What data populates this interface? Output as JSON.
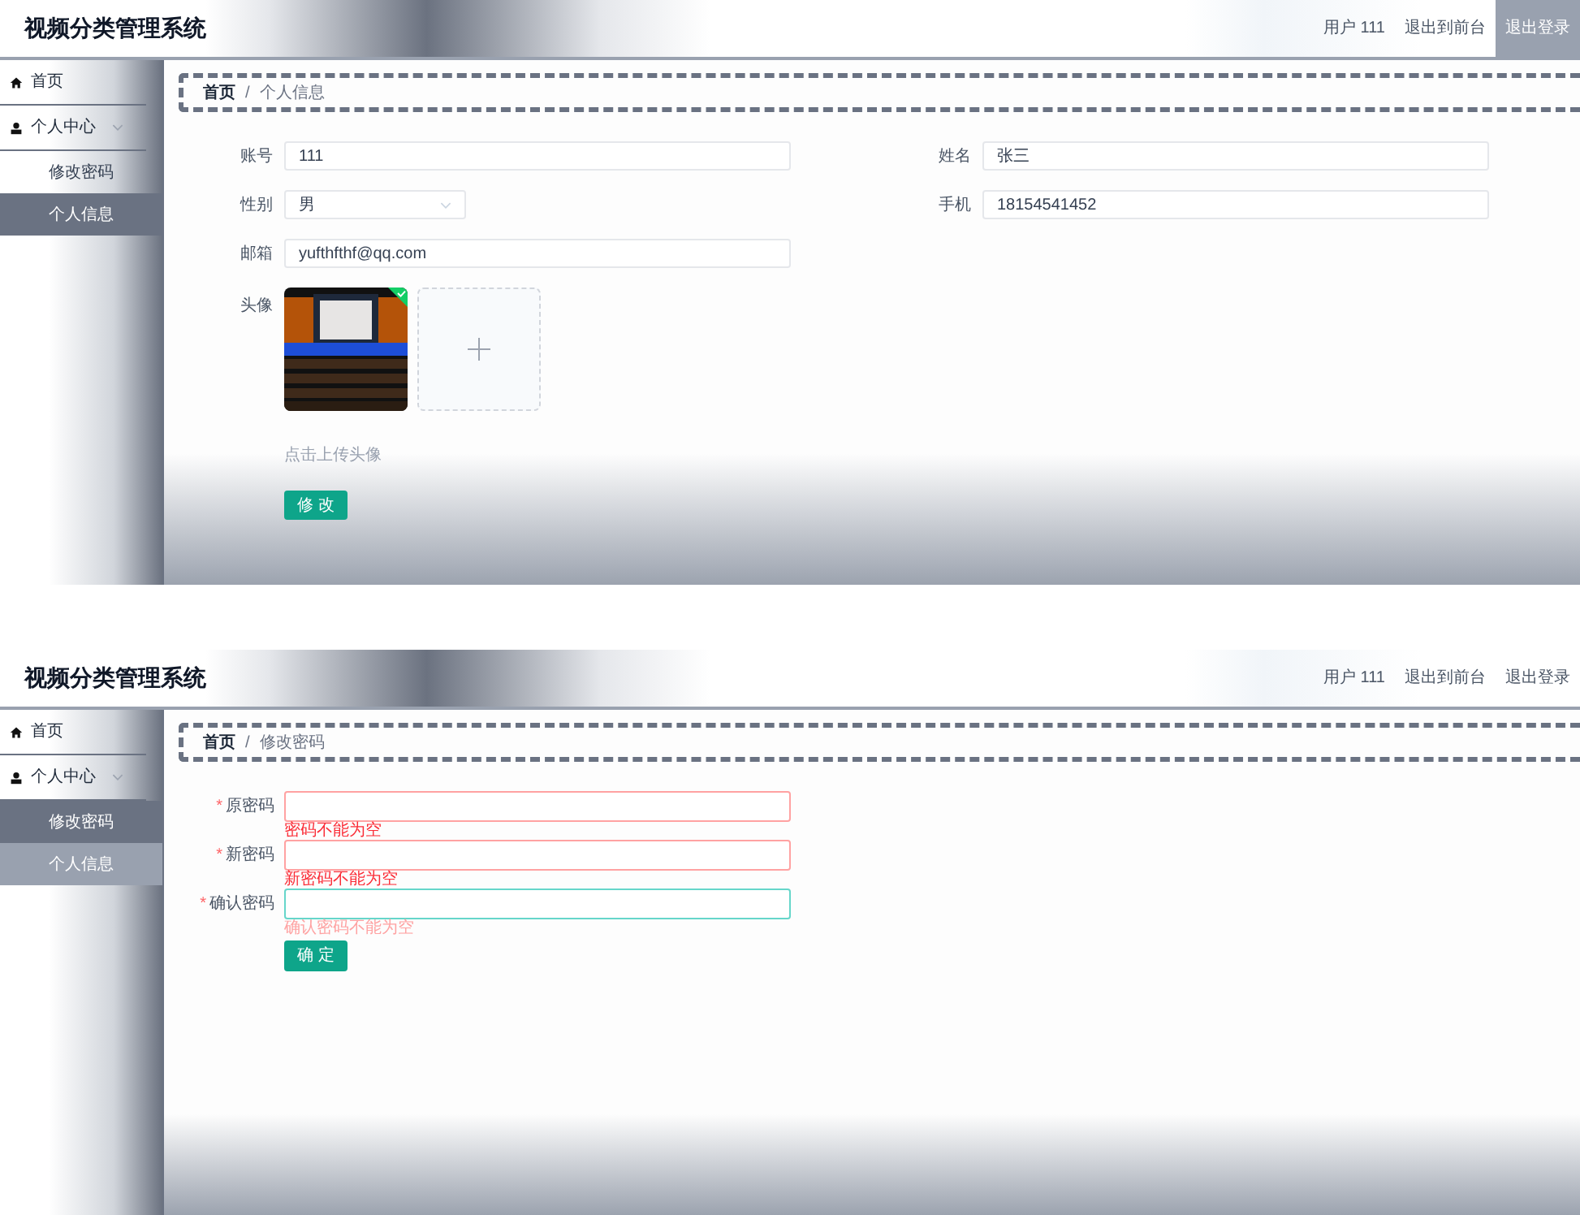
{
  "screens": [
    {
      "kind": "profile",
      "header": {
        "title": "视频分类管理系统",
        "links": [
          {
            "label": "用户 111",
            "hovered": false
          },
          {
            "label": "退出到前台",
            "hovered": false
          },
          {
            "label": "退出登录",
            "hovered": true
          }
        ]
      },
      "sidebar": [
        {
          "kind": "home",
          "label": "首页"
        },
        {
          "kind": "group",
          "label": "个人中心",
          "expanded": true,
          "children": [
            {
              "label": "修改密码",
              "selected": false,
              "hovered": false
            },
            {
              "label": "个人信息",
              "selected": true,
              "hovered": false
            }
          ]
        }
      ],
      "breadcrumb": [
        "首页",
        "/",
        "个人信息"
      ],
      "rows": [
        [
          {
            "label": "账号",
            "value": "111",
            "kind": "text"
          },
          {
            "label": "姓名",
            "value": "张三",
            "kind": "text"
          }
        ],
        [
          {
            "label": "性别",
            "value": "男",
            "kind": "select"
          },
          {
            "label": "手机",
            "value": "18154541452",
            "kind": "text"
          }
        ],
        [
          {
            "label": "邮箱",
            "value": "yufthfthf@qq.com",
            "kind": "text"
          }
        ]
      ],
      "avatar": {
        "label": "头像",
        "kind": "picture",
        "uploaded": true,
        "hint": "点击上传头像"
      },
      "button": "修 改"
    },
    {
      "kind": "password",
      "header": {
        "title": "视频分类管理系统",
        "links": [
          {
            "label": "用户 111",
            "hovered": false
          },
          {
            "label": "退出到前台",
            "hovered": false
          },
          {
            "label": "退出登录",
            "hovered": false
          }
        ]
      },
      "sidebar": [
        {
          "kind": "home",
          "label": "首页"
        },
        {
          "kind": "group",
          "label": "个人中心",
          "expanded": true,
          "children": [
            {
              "label": "修改密码",
              "selected": true,
              "hovered": false
            },
            {
              "label": "个人信息",
              "selected": false,
              "hovered": true
            }
          ]
        }
      ],
      "breadcrumb": [
        "首页",
        "/",
        "修改密码"
      ],
      "fields": [
        {
          "label": "原密码",
          "required": "*",
          "invalid": true,
          "focused": false,
          "error": "密码不能为空"
        },
        {
          "label": "新密码",
          "required": "*",
          "invalid": true,
          "focused": false,
          "error": "新密码不能为空"
        },
        {
          "label": "确认密码",
          "required": "*",
          "invalid": false,
          "focused": true,
          "error": "确认密码不能为空"
        }
      ],
      "button": "确 定"
    }
  ]
}
